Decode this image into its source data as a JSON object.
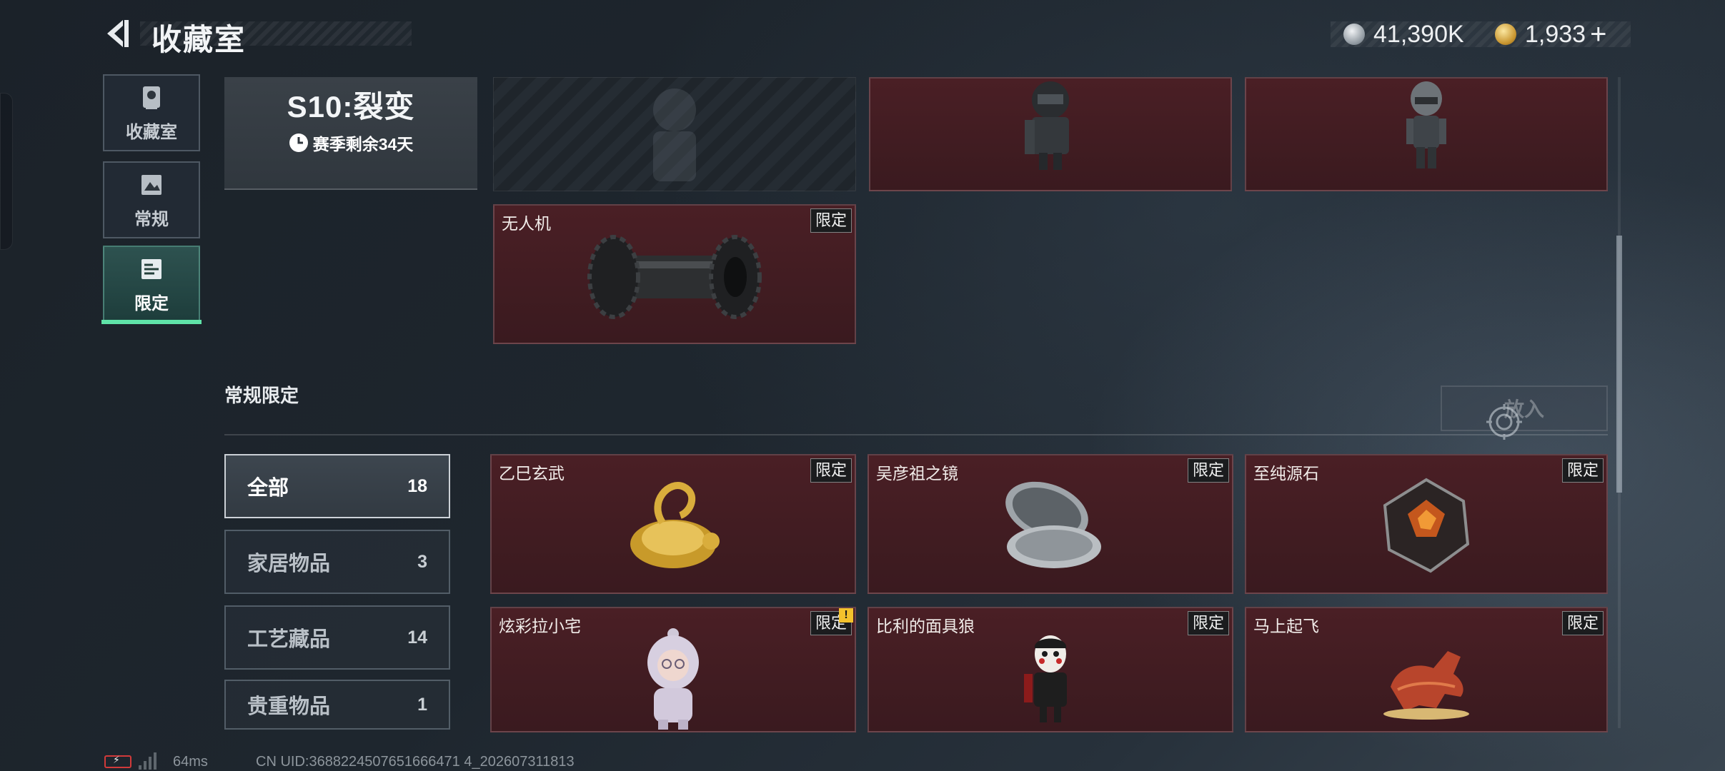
{
  "header": {
    "title": "收藏室",
    "currency": [
      {
        "icon": "silver-coin-icon",
        "amount": "41,390K"
      },
      {
        "icon": "gold-coin-icon",
        "amount": "1,933"
      }
    ],
    "add_label": "+"
  },
  "sidebar": {
    "items": [
      {
        "label": "收藏室",
        "icon": "trophy-icon",
        "active": false
      },
      {
        "label": "常规",
        "icon": "picture-icon",
        "active": false
      },
      {
        "label": "限定",
        "icon": "limited-icon",
        "active": true
      }
    ]
  },
  "season": {
    "name": "S10:裂变",
    "remaining": "赛季剩余34天"
  },
  "top_cards": [
    {
      "name": "",
      "tag": "",
      "empty": true
    },
    {
      "name": "",
      "tag": "",
      "empty": false
    },
    {
      "name": "",
      "tag": "",
      "empty": false
    },
    {
      "name": "无人机",
      "tag": "限定",
      "empty": false
    }
  ],
  "section": {
    "title": "常规限定",
    "place_button": "放入"
  },
  "filters": [
    {
      "label": "全部",
      "count": "18",
      "active": true
    },
    {
      "label": "家居物品",
      "count": "3",
      "active": false
    },
    {
      "label": "工艺藏品",
      "count": "14",
      "active": false
    },
    {
      "label": "贵重物品",
      "count": "1",
      "active": false
    }
  ],
  "items": [
    {
      "name": "乙巳玄武",
      "tag": "限定"
    },
    {
      "name": "吴彦祖之镜",
      "tag": "限定"
    },
    {
      "name": "至纯源石",
      "tag": "限定"
    },
    {
      "name": "炫彩拉小宅",
      "tag": "限定",
      "alert": "!"
    },
    {
      "name": "比利的面具狼",
      "tag": "限定"
    },
    {
      "name": "马上起飞",
      "tag": "限定"
    }
  ],
  "footer": {
    "ping": "64ms",
    "uid": "CN UID:3688224507651666471 4_202607311813"
  }
}
